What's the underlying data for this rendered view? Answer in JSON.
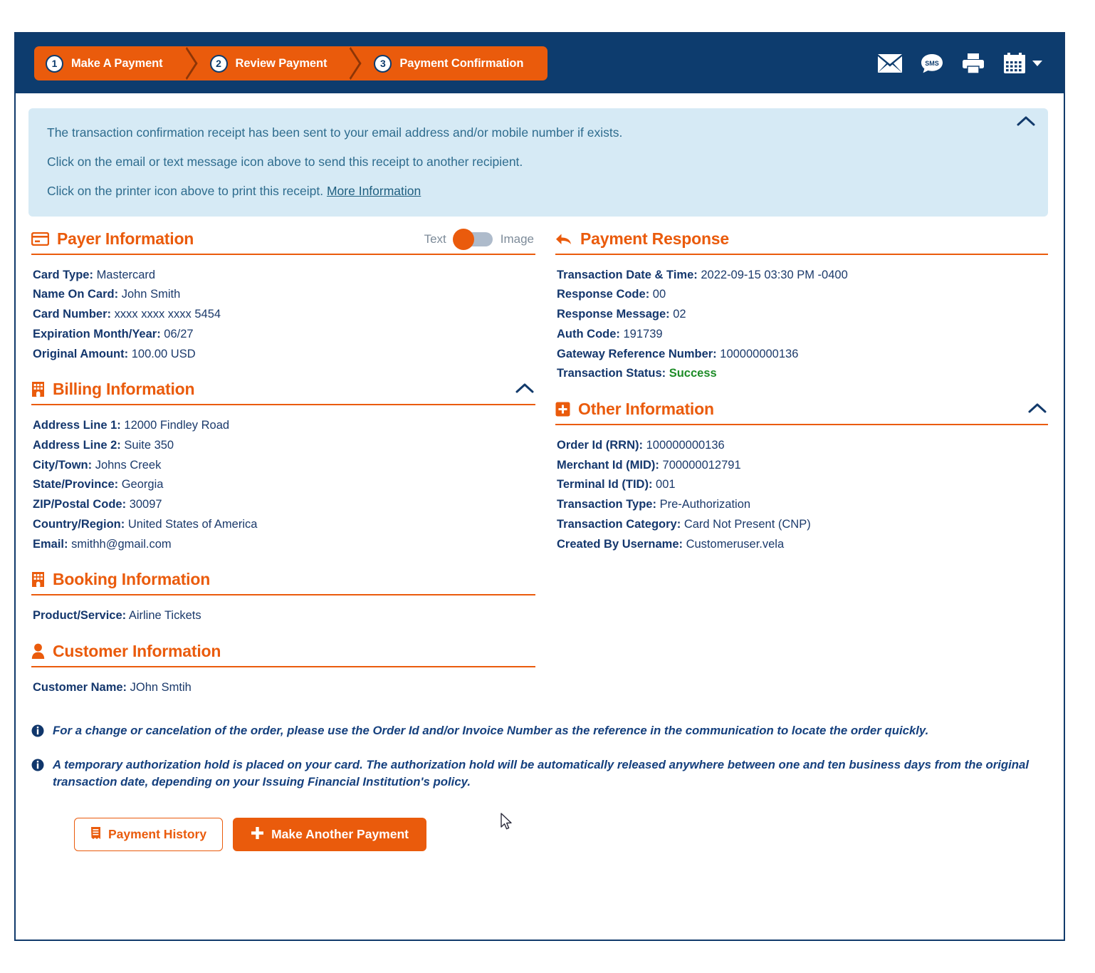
{
  "header": {
    "steps": [
      {
        "num": "1",
        "label": "Make A Payment"
      },
      {
        "num": "2",
        "label": "Review Payment"
      },
      {
        "num": "3",
        "label": "Payment Confirmation"
      }
    ],
    "icons": [
      {
        "name": "email-icon",
        "title": "Email receipt"
      },
      {
        "name": "sms-icon",
        "title": "Text receipt",
        "glyph": "SMS"
      },
      {
        "name": "printer-icon",
        "title": "Print receipt"
      },
      {
        "name": "calendar-icon",
        "title": "Calendar"
      }
    ]
  },
  "banner": {
    "line1": "The transaction confirmation receipt has been sent to your email address and/or mobile number if exists.",
    "line2": "Click on the email or text message icon above to send this receipt to another recipient.",
    "line3_prefix": "Click on the printer icon above to print this receipt. ",
    "line3_link": "More Information"
  },
  "payer": {
    "title": "Payer Information",
    "toggle": {
      "left_label": "Text",
      "right_label": "Image",
      "selected": "Text"
    },
    "fields": [
      {
        "key": "Card Type:",
        "value": "Mastercard"
      },
      {
        "key": "Name On Card:",
        "value": "John Smith"
      },
      {
        "key": "Card Number:",
        "value": "xxxx xxxx xxxx 5454"
      },
      {
        "key": "Expiration Month/Year:",
        "value": "06/27"
      },
      {
        "key": "Original Amount:",
        "value": "100.00 USD"
      }
    ]
  },
  "billing": {
    "title": "Billing Information",
    "fields": [
      {
        "key": "Address Line 1:",
        "value": "12000 Findley Road"
      },
      {
        "key": "Address Line 2:",
        "value": "Suite 350"
      },
      {
        "key": "City/Town:",
        "value": "Johns Creek"
      },
      {
        "key": "State/Province:",
        "value": "Georgia"
      },
      {
        "key": "ZIP/Postal Code:",
        "value": "30097"
      },
      {
        "key": "Country/Region:",
        "value": "United States of America"
      },
      {
        "key": "Email:",
        "value": "smithh@gmail.com"
      }
    ]
  },
  "booking": {
    "title": "Booking Information",
    "fields": [
      {
        "key": "Product/Service:",
        "value": "Airline Tickets"
      }
    ]
  },
  "customer": {
    "title": "Customer Information",
    "fields": [
      {
        "key": "Customer Name:",
        "value": "JOhn Smtih"
      }
    ]
  },
  "payment_response": {
    "title": "Payment Response",
    "fields": [
      {
        "key": "Transaction Date & Time:",
        "value": "2022-09-15 03:30 PM -0400"
      },
      {
        "key": "Response Code:",
        "value": "00"
      },
      {
        "key": "Response Message:",
        "value": "02"
      },
      {
        "key": "Auth Code:",
        "value": "191739"
      },
      {
        "key": "Gateway Reference Number:",
        "value": "100000000136"
      },
      {
        "key": "Transaction Status:",
        "value": "Success",
        "status": "success"
      }
    ]
  },
  "other": {
    "title": "Other Information",
    "fields": [
      {
        "key": "Order Id (RRN):",
        "value": "100000000136"
      },
      {
        "key": "Merchant Id (MID):",
        "value": "700000012791"
      },
      {
        "key": "Terminal Id (TID):",
        "value": "001"
      },
      {
        "key": "Transaction Type:",
        "value": "Pre-Authorization"
      },
      {
        "key": "Transaction Category:",
        "value": "Card Not Present (CNP)"
      },
      {
        "key": "Created By Username:",
        "value": "Customeruser.vela"
      }
    ]
  },
  "notes": [
    "For a change or cancelation of the order, please use the Order Id and/or Invoice Number as the reference in the communication to locate the order quickly.",
    "A temporary authorization hold is placed on your card. The authorization hold will be automatically released anywhere between one and ten business days from the original transaction date, depending on your Issuing Financial Institution's policy."
  ],
  "buttons": {
    "history_label": "Payment History",
    "another_label": "Make Another Payment"
  },
  "colors": {
    "navy": "#0D3C6E",
    "orange": "#EA5B0C",
    "banner_bg": "#D6EAF5",
    "banner_text": "#2E6C8E",
    "success_green": "#1E8C28",
    "field_text": "#1B3A6B"
  }
}
